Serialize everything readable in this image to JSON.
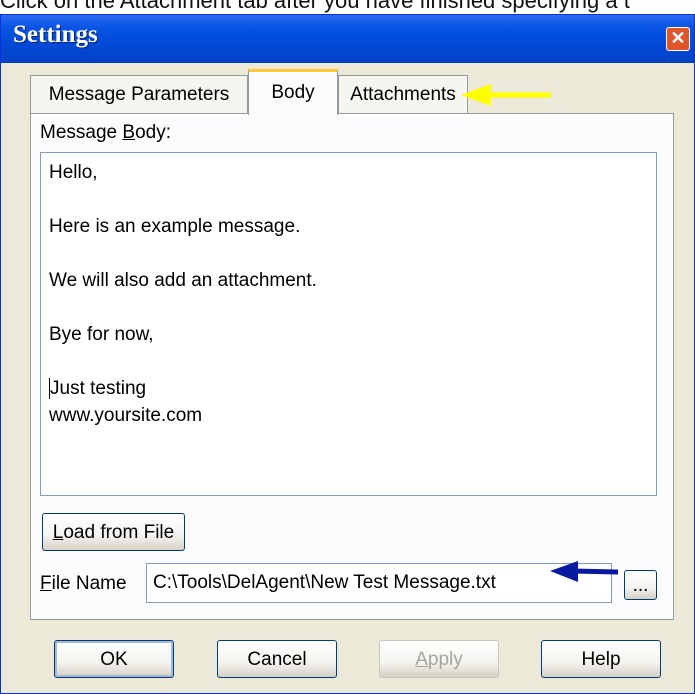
{
  "caption": "Click on the Attachment tab after you have finished specifying a t",
  "window": {
    "title": "Settings",
    "close_glyph": "✕"
  },
  "tabs": [
    {
      "label": "Message Parameters",
      "active": false
    },
    {
      "label": "Body",
      "active": true
    },
    {
      "label": "Attachments",
      "active": false
    }
  ],
  "body": {
    "message_body_label_pre": "Message ",
    "message_body_label_mn": "B",
    "message_body_label_post": "ody:",
    "lines": [
      "Hello,",
      "",
      "Here is an example message.",
      "",
      "We will also add an attachment.",
      "",
      "Bye for now,",
      "",
      "Just testing",
      "www.yoursite.com"
    ],
    "load_button_mn": "L",
    "load_button_rest": "oad from File",
    "file_name_label_mn": "F",
    "file_name_label_rest": "ile Name",
    "file_name_value": "C:\\Tools\\DelAgent\\New Test Message.txt",
    "browse_label": "..."
  },
  "footer": {
    "ok": "OK",
    "cancel": "Cancel",
    "apply_mn": "A",
    "apply_rest": "pply",
    "help": "Help"
  },
  "annotations": {
    "attachments_arrow_color": "#ffff00",
    "filename_arrow_color": "#0a1aa0"
  }
}
